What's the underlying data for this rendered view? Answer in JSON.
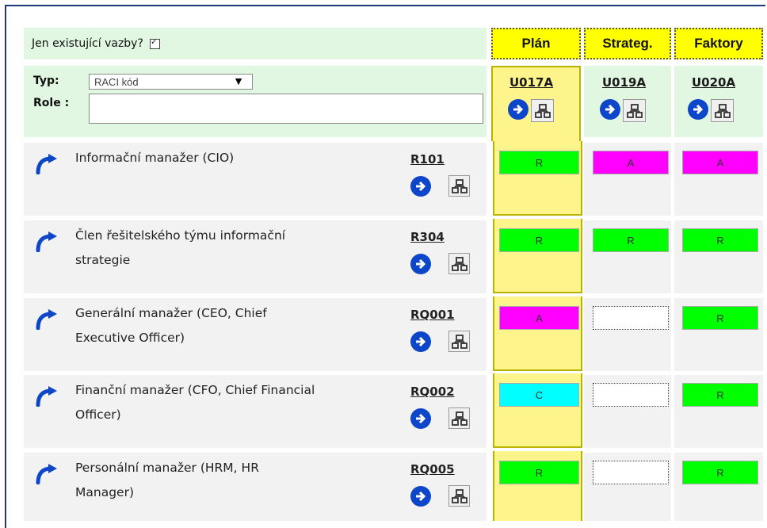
{
  "header": {
    "only_existing_label": "Jen existující vazby?",
    "only_existing_checked": true,
    "columns": [
      {
        "title": "Plán",
        "code": "U017A"
      },
      {
        "title": "Strateg.",
        "code": "U019A"
      },
      {
        "title": "Faktory",
        "code": "U020A"
      }
    ]
  },
  "filter": {
    "type_label": "Typ:",
    "type_value": "RACI kód",
    "role_label": "Role :",
    "role_value": ""
  },
  "rows": [
    {
      "name_line1": "Informační manažer (CIO)",
      "name_line2": "",
      "code": "R101",
      "cells": [
        "R",
        "A",
        "A"
      ]
    },
    {
      "name_line1": "Člen řešitelského týmu informační",
      "name_line2": "strategie",
      "code": "R304",
      "cells": [
        "R",
        "R",
        "R"
      ]
    },
    {
      "name_line1": "Generální manažer (CEO, Chief",
      "name_line2": "Executive Officer)",
      "code": "RQ001",
      "cells": [
        "A",
        "",
        "R"
      ]
    },
    {
      "name_line1": "Finanční manažer (CFO, Chief Financial",
      "name_line2": "Officer)",
      "code": "RQ002",
      "cells": [
        "C",
        "",
        "R"
      ]
    },
    {
      "name_line1": "Personální manažer (HRM, HR",
      "name_line2": "Manager)",
      "code": "RQ005",
      "cells": [
        "R",
        "",
        "R"
      ]
    }
  ],
  "colors": {
    "R": "#00ff00",
    "A": "#ff00ff",
    "C": "#00ffff",
    "plan_highlight": "#fdf58b",
    "link_blue": "#0d46c9"
  },
  "icons": [
    "curved-arrow-icon",
    "go-arrow-icon",
    "tree-icon",
    "checkbox-icon"
  ]
}
